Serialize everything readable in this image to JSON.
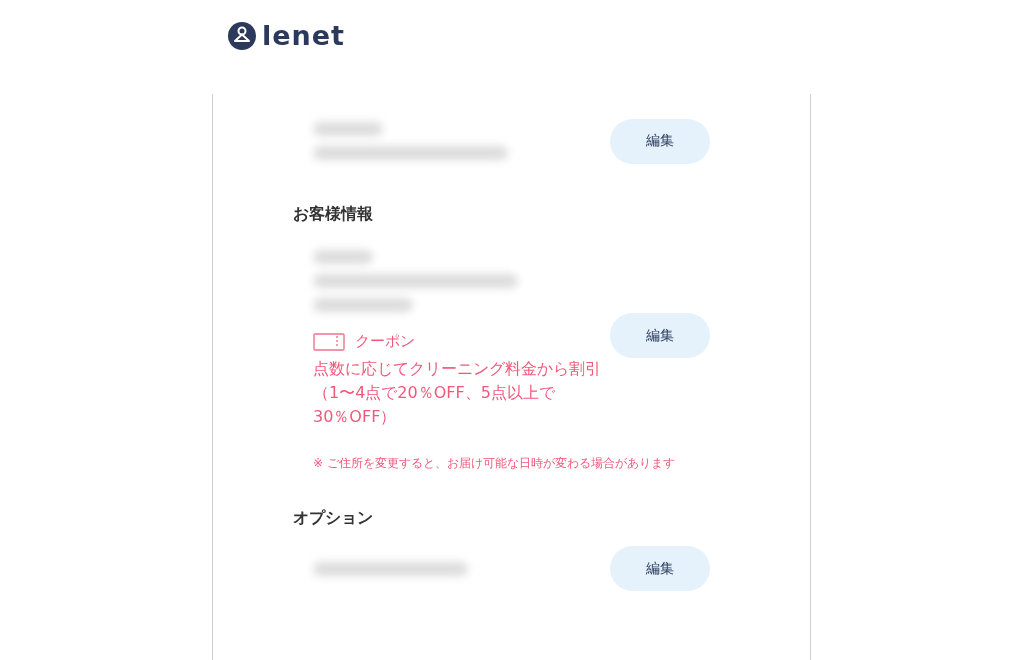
{
  "header": {
    "logo_text": "lenet"
  },
  "sections": [
    {
      "kind": "address",
      "edit_button": "編集"
    },
    {
      "kind": "customer",
      "heading": "お客様情報",
      "edit_button": "編集",
      "coupon": {
        "label": "クーポン",
        "description": "点数に応じてクリーニング料金から割引（1〜4点で20％OFF、5点以上で30％OFF）"
      },
      "note": "※ ご住所を変更すると、お届け可能な日時が変わる場合があります"
    },
    {
      "kind": "option",
      "heading": "オプション",
      "edit_button": "編集"
    }
  ]
}
